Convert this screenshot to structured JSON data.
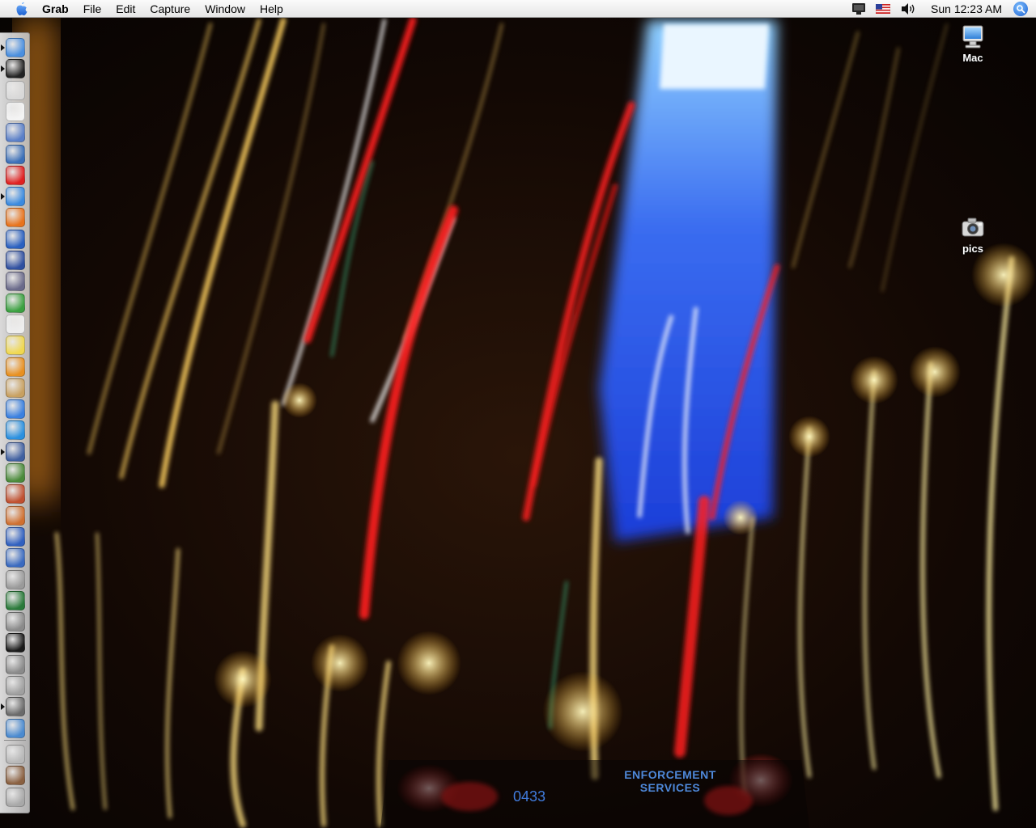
{
  "menubar": {
    "apple_icon": "apple-icon",
    "app_name": "Grab",
    "menus": [
      "File",
      "Edit",
      "Capture",
      "Window",
      "Help"
    ],
    "status_icons": [
      "display-icon",
      "us-flag-icon",
      "volume-icon"
    ],
    "clock": "Sun 12:23 AM",
    "spotlight_icon": "spotlight-icon"
  },
  "desktop": {
    "icons": [
      {
        "label": "Mac",
        "icon": "computer-icon"
      },
      {
        "label": "pics",
        "icon": "camera-icon"
      }
    ],
    "wallpaper": {
      "caption_line1": "ENFORCEMENT",
      "caption_line2": "SERVICES",
      "plate": "0433"
    }
  },
  "dock": {
    "position": "left",
    "items": [
      {
        "icon": "finder-icon",
        "color": "#4a8fe0",
        "running": true
      },
      {
        "icon": "dashboard-icon",
        "color": "#222222",
        "running": true
      },
      {
        "icon": "apple-logo-icon",
        "color": "#d8d8d8",
        "running": false
      },
      {
        "icon": "ical-icon",
        "color": "#f4f4f4",
        "running": false
      },
      {
        "icon": "preview-icon",
        "color": "#5a7fc8",
        "running": false
      },
      {
        "icon": "thunderbird-icon",
        "color": "#3b6fb8",
        "running": false
      },
      {
        "icon": "opera-icon",
        "color": "#e02020",
        "running": false
      },
      {
        "icon": "safari-icon",
        "color": "#3a8ae0",
        "running": true
      },
      {
        "icon": "firefox-icon",
        "color": "#e8731c",
        "running": false
      },
      {
        "icon": "google-earth-icon",
        "color": "#2a60c0",
        "running": false
      },
      {
        "icon": "network-icon",
        "color": "#3050a0",
        "running": false
      },
      {
        "icon": "script-editor-icon",
        "color": "#6a6a8a",
        "running": false
      },
      {
        "icon": "adium-icon",
        "color": "#3aa040",
        "running": false
      },
      {
        "icon": "textedit-icon",
        "color": "#eeeeee",
        "running": false
      },
      {
        "icon": "stickies-icon",
        "color": "#f0d850",
        "running": false
      },
      {
        "icon": "butterfly-icon",
        "color": "#e89020",
        "running": false
      },
      {
        "icon": "garageband-icon",
        "color": "#c8a060",
        "running": false
      },
      {
        "icon": "itunes-icon",
        "color": "#3a80e0",
        "running": false
      },
      {
        "icon": "quicktime-icon",
        "color": "#2a90e0",
        "running": false
      },
      {
        "icon": "iphoto-icon",
        "color": "#4060a0",
        "running": true
      },
      {
        "icon": "sync-icon",
        "color": "#4a8a3a",
        "running": false
      },
      {
        "icon": "photo-booth-icon",
        "color": "#c05030",
        "running": false
      },
      {
        "icon": "keynote-icon",
        "color": "#d07030",
        "running": false
      },
      {
        "icon": "imovie-icon",
        "color": "#3060c0",
        "running": false
      },
      {
        "icon": "dvd-player-icon",
        "color": "#3a6ac0",
        "running": false
      },
      {
        "icon": "system-preferences-icon",
        "color": "#9a9a9a",
        "running": false
      },
      {
        "icon": "activity-monitor-icon",
        "color": "#2a7a3a",
        "running": false
      },
      {
        "icon": "calculator-icon",
        "color": "#8a8a8a",
        "running": false
      },
      {
        "icon": "terminal-icon",
        "color": "#1a1a1a",
        "running": false
      },
      {
        "icon": "automator-icon",
        "color": "#8a8a8a",
        "running": false
      },
      {
        "icon": "disk-utility-icon",
        "color": "#a0a0a0",
        "running": false
      },
      {
        "icon": "grab-icon",
        "color": "#6a6a6a",
        "running": true
      },
      {
        "icon": "monitor-icon",
        "color": "#4a8ad0",
        "running": false
      },
      {
        "icon": "downloads-stack-icon",
        "color": "#b8b8b8",
        "running": false
      },
      {
        "icon": "pictures-stack-icon",
        "color": "#8a6040",
        "running": false
      },
      {
        "icon": "trash-icon",
        "color": "#a8a8a8",
        "running": false
      }
    ]
  }
}
